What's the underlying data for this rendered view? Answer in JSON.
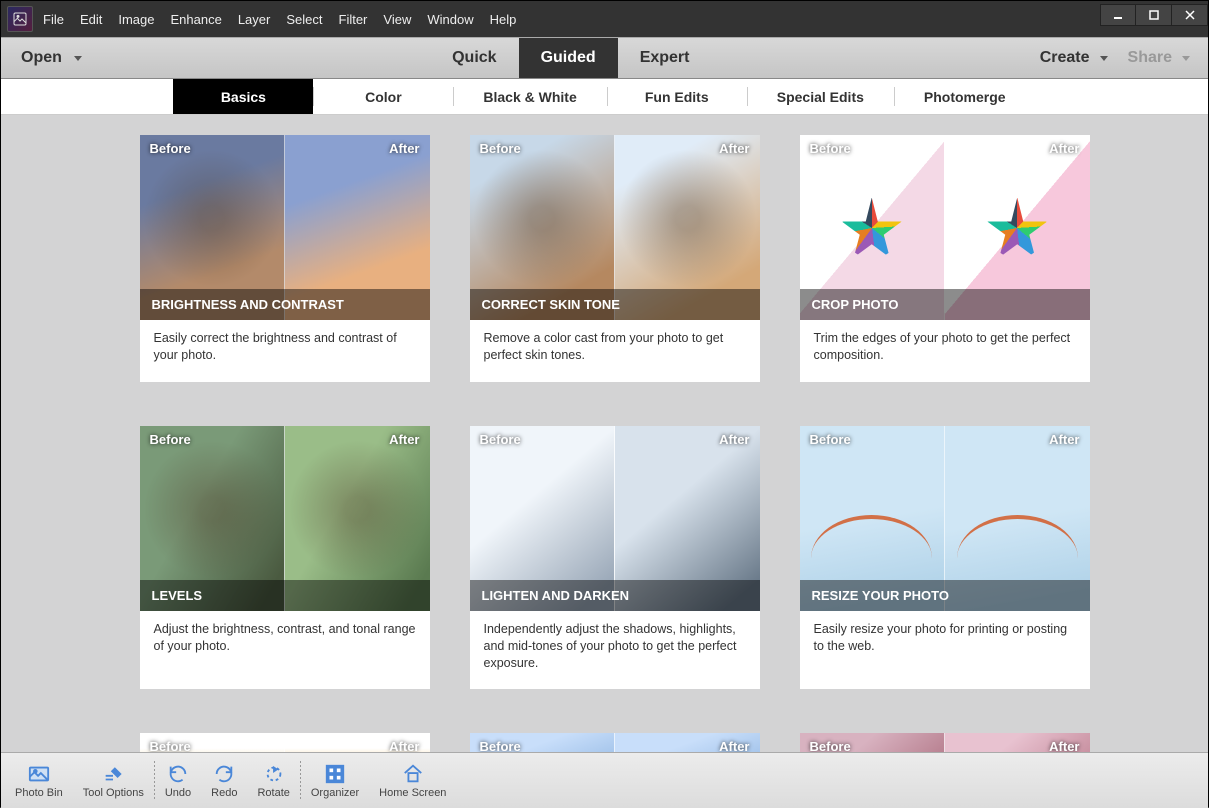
{
  "menu": [
    "File",
    "Edit",
    "Image",
    "Enhance",
    "Layer",
    "Select",
    "Filter",
    "View",
    "Window",
    "Help"
  ],
  "toolbar": {
    "open": "Open",
    "modes": [
      "Quick",
      "Guided",
      "Expert"
    ],
    "active_mode": "Guided",
    "create": "Create",
    "share": "Share"
  },
  "subtabs": [
    "Basics",
    "Color",
    "Black & White",
    "Fun Edits",
    "Special Edits",
    "Photomerge"
  ],
  "active_subtab": "Basics",
  "labels": {
    "before": "Before",
    "after": "After"
  },
  "cards": [
    {
      "title": "BRIGHTNESS AND CONTRAST",
      "desc": "Easily correct the brightness and contrast of your photo.",
      "ta": "t1a",
      "tb": "t1b",
      "extraA": "vignette",
      "extraB": ""
    },
    {
      "title": "CORRECT SKIN TONE",
      "desc": "Remove a color cast from your photo to get perfect skin tones.",
      "ta": "t2a",
      "tb": "t2b",
      "extraA": "vignette",
      "extraB": "vignette"
    },
    {
      "title": "CROP PHOTO",
      "desc": "Trim the edges of your photo to get the perfect composition.",
      "ta": "t3a",
      "tb": "t3b",
      "extraA": "pencils",
      "extraB": "pencils"
    },
    {
      "title": "LEVELS",
      "desc": "Adjust the brightness, contrast, and tonal range of your photo.",
      "ta": "t4a",
      "tb": "t4b",
      "extraA": "vignette",
      "extraB": "vignette"
    },
    {
      "title": "LIGHTEN AND DARKEN",
      "desc": "Independently adjust the shadows, highlights, and mid-tones of your photo to get the perfect exposure.",
      "ta": "t5a",
      "tb": "t5b",
      "extraA": "",
      "extraB": ""
    },
    {
      "title": "RESIZE YOUR PHOTO",
      "desc": "Easily resize your photo for printing or posting to the web.",
      "ta": "t6a",
      "tb": "t6b",
      "extraA": "bridge",
      "extraB": "bridge"
    },
    {
      "title": "",
      "desc": "",
      "ta": "t7a",
      "tb": "t7b",
      "extraA": "",
      "extraB": "",
      "short": true
    },
    {
      "title": "",
      "desc": "",
      "ta": "t8a",
      "tb": "t8b",
      "extraA": "",
      "extraB": "",
      "short": true
    },
    {
      "title": "",
      "desc": "",
      "ta": "t9a",
      "tb": "t9b",
      "extraA": "",
      "extraB": "",
      "short": true
    }
  ],
  "bottom": [
    {
      "id": "photo-bin",
      "label": "Photo Bin"
    },
    {
      "id": "tool-options",
      "label": "Tool Options"
    },
    {
      "id": "undo",
      "label": "Undo"
    },
    {
      "id": "redo",
      "label": "Redo"
    },
    {
      "id": "rotate",
      "label": "Rotate"
    },
    {
      "id": "organizer",
      "label": "Organizer"
    },
    {
      "id": "home-screen",
      "label": "Home Screen"
    }
  ]
}
